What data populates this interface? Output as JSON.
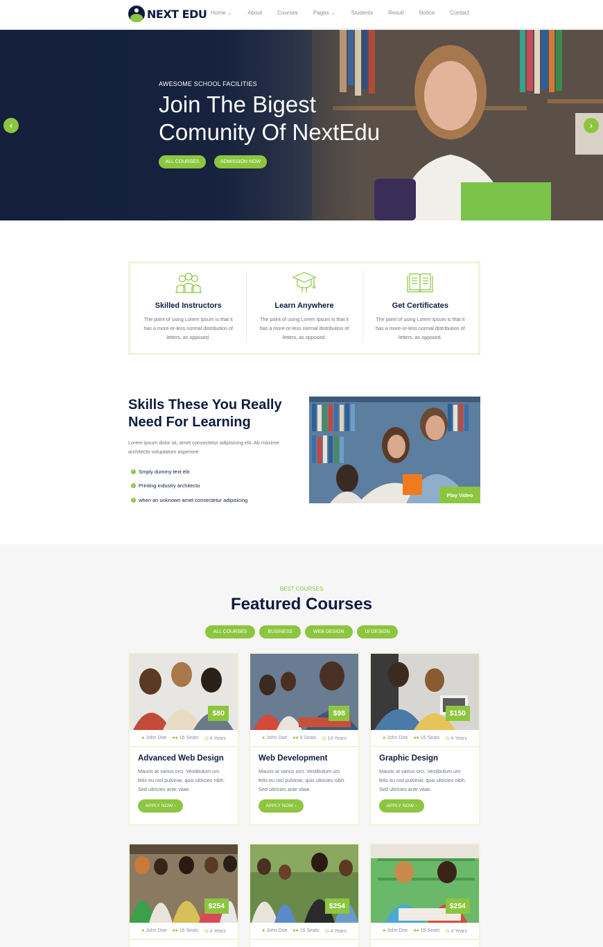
{
  "brand": {
    "name": "NEXT EDU",
    "accent": "#8cc63f",
    "navy": "#0d1b3e"
  },
  "nav": [
    {
      "label": "Home",
      "dropdown": true
    },
    {
      "label": "About",
      "dropdown": false
    },
    {
      "label": "Courses",
      "dropdown": false
    },
    {
      "label": "Pages",
      "dropdown": true
    },
    {
      "label": "Students",
      "dropdown": false
    },
    {
      "label": "Result",
      "dropdown": false
    },
    {
      "label": "Notice",
      "dropdown": false
    },
    {
      "label": "Contact",
      "dropdown": false
    }
  ],
  "hero": {
    "eyebrow": "AWESOME SCHOOL FACILITIES",
    "title_line1": "Join The Bigest",
    "title_line2": "Comunity Of NextEdu",
    "btn_courses": "ALL COURSES",
    "btn_admission": "ADMISSION NOW",
    "prev_icon": "‹",
    "next_icon": "›"
  },
  "features": [
    {
      "title": "Skilled Instructors",
      "text": "The point of using Lorem Ipsum is that it has a more-or-less normal distribution of letters, as opposed.",
      "icon": "instructors-icon"
    },
    {
      "title": "Learn Anywhere",
      "text": "The point of using Lorem Ipsum is that it has a more-or-less normal distribution of letters, as opposed.",
      "icon": "graduation-cap-icon"
    },
    {
      "title": "Get Certificates",
      "text": "The point of using Lorem Ipsum is that it has a more-or-less normal distribution of letters, as opposed.",
      "icon": "book-icon"
    }
  ],
  "skills": {
    "title": "Skills These You Really Need For Learning",
    "desc": "Lorem ipsum dolor sit, amet consectetur adipisicing elit. Ab maxime architecto voluptatum asperiore",
    "items": [
      "Smply dummy text elit",
      "Printing industry architecto",
      "when an unknown amet consectetur adipisicing"
    ],
    "play_label": "Play Video"
  },
  "courses": {
    "eyebrow": "BEST COURSES",
    "title": "Featured Courses",
    "filters": [
      "ALL COURSES",
      "BUSINESS",
      "WEB DESIGN",
      "UI DESIGN"
    ],
    "cards": [
      {
        "price": "$80",
        "author": "John Doe",
        "seats": "16 Seats",
        "duration": "4 Years",
        "title": "Advanced Web Design",
        "text": "Mauris at varius orci. Vestibulum um felis eu nisl pulvinar, quis ultricies nibh. Sed ultricies ante vitae.",
        "apply": "APPLY NOW"
      },
      {
        "price": "$98",
        "author": "John Doe",
        "seats": "6 Seats",
        "duration": "14 Years",
        "title": "Web Development",
        "text": "Mauris at varius orci. Vestibulum um felis eu nisl pulvinar, quis ultricies nibh. Sed ultricies ante vitae.",
        "apply": "APPLY NOW"
      },
      {
        "price": "$150",
        "author": "John Doe",
        "seats": "16 Seats",
        "duration": "4 Years",
        "title": "Graphic Design",
        "text": "Mauris at varius orci. Vestibulum um felis eu nisl pulvinar, quis ultricies nibh. Sed ultricies ante vitae.",
        "apply": "APPLY NOW"
      },
      {
        "price": "$254",
        "author": "John Doe",
        "seats": "16 Seats",
        "duration": "4 Years"
      },
      {
        "price": "$254",
        "author": "John Doe",
        "seats": "16 Seats",
        "duration": "4 Years"
      },
      {
        "price": "$254",
        "author": "John Doe",
        "seats": "16 Seats",
        "duration": "4 Years"
      }
    ]
  }
}
